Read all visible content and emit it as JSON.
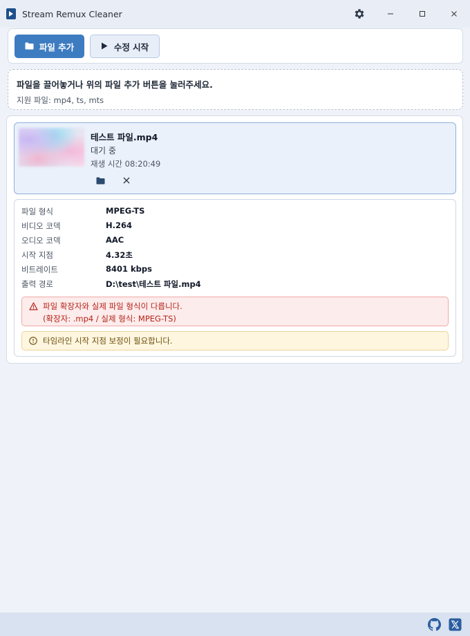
{
  "window": {
    "title": "Stream Remux Cleaner",
    "app_icon": "play-square-icon",
    "controls": [
      "settings-gear-icon",
      "minimize-icon",
      "maximize-icon",
      "close-icon"
    ]
  },
  "toolbar": {
    "add_file_label": "파일 추가",
    "add_file_icon": "folder-icon",
    "start_fix_label": "수정 시작",
    "start_fix_icon": "play-icon"
  },
  "drop_zone": {
    "hint": "파일을 끌어놓거나 위의 파일 추가 버튼을 눌러주세요.",
    "supported": "지원 파일: mp4, ts, mts"
  },
  "files": [
    {
      "name": "테스트 파일.mp4",
      "status": "대기 중",
      "duration": "재생 시간 08:20:49",
      "details": [
        {
          "label": "파일 형식",
          "value": "MPEG-TS"
        },
        {
          "label": "비디오 코덱",
          "value": "H.264"
        },
        {
          "label": "오디오 코덱",
          "value": "AAC"
        },
        {
          "label": "시작 지점",
          "value": "4.32초"
        },
        {
          "label": "비트레이트",
          "value": "8401 kbps"
        },
        {
          "label": "출력 경로",
          "value": "D:\\test\\테스트 파일.mp4"
        }
      ],
      "error": {
        "line1": "파일 확장자와 실제 파일 형식이 다릅니다.",
        "line2": "(확장자: .mp4 / 실제 형식: MPEG-TS)"
      },
      "warning": "타임라인 시작 지점 보정이 필요합니다."
    }
  ],
  "statusbar": {
    "icons": [
      "github-icon",
      "x-twitter-icon"
    ]
  },
  "colors": {
    "accent": "#3d7cc0",
    "error": "#b42318",
    "warning": "#6b4e0b"
  }
}
